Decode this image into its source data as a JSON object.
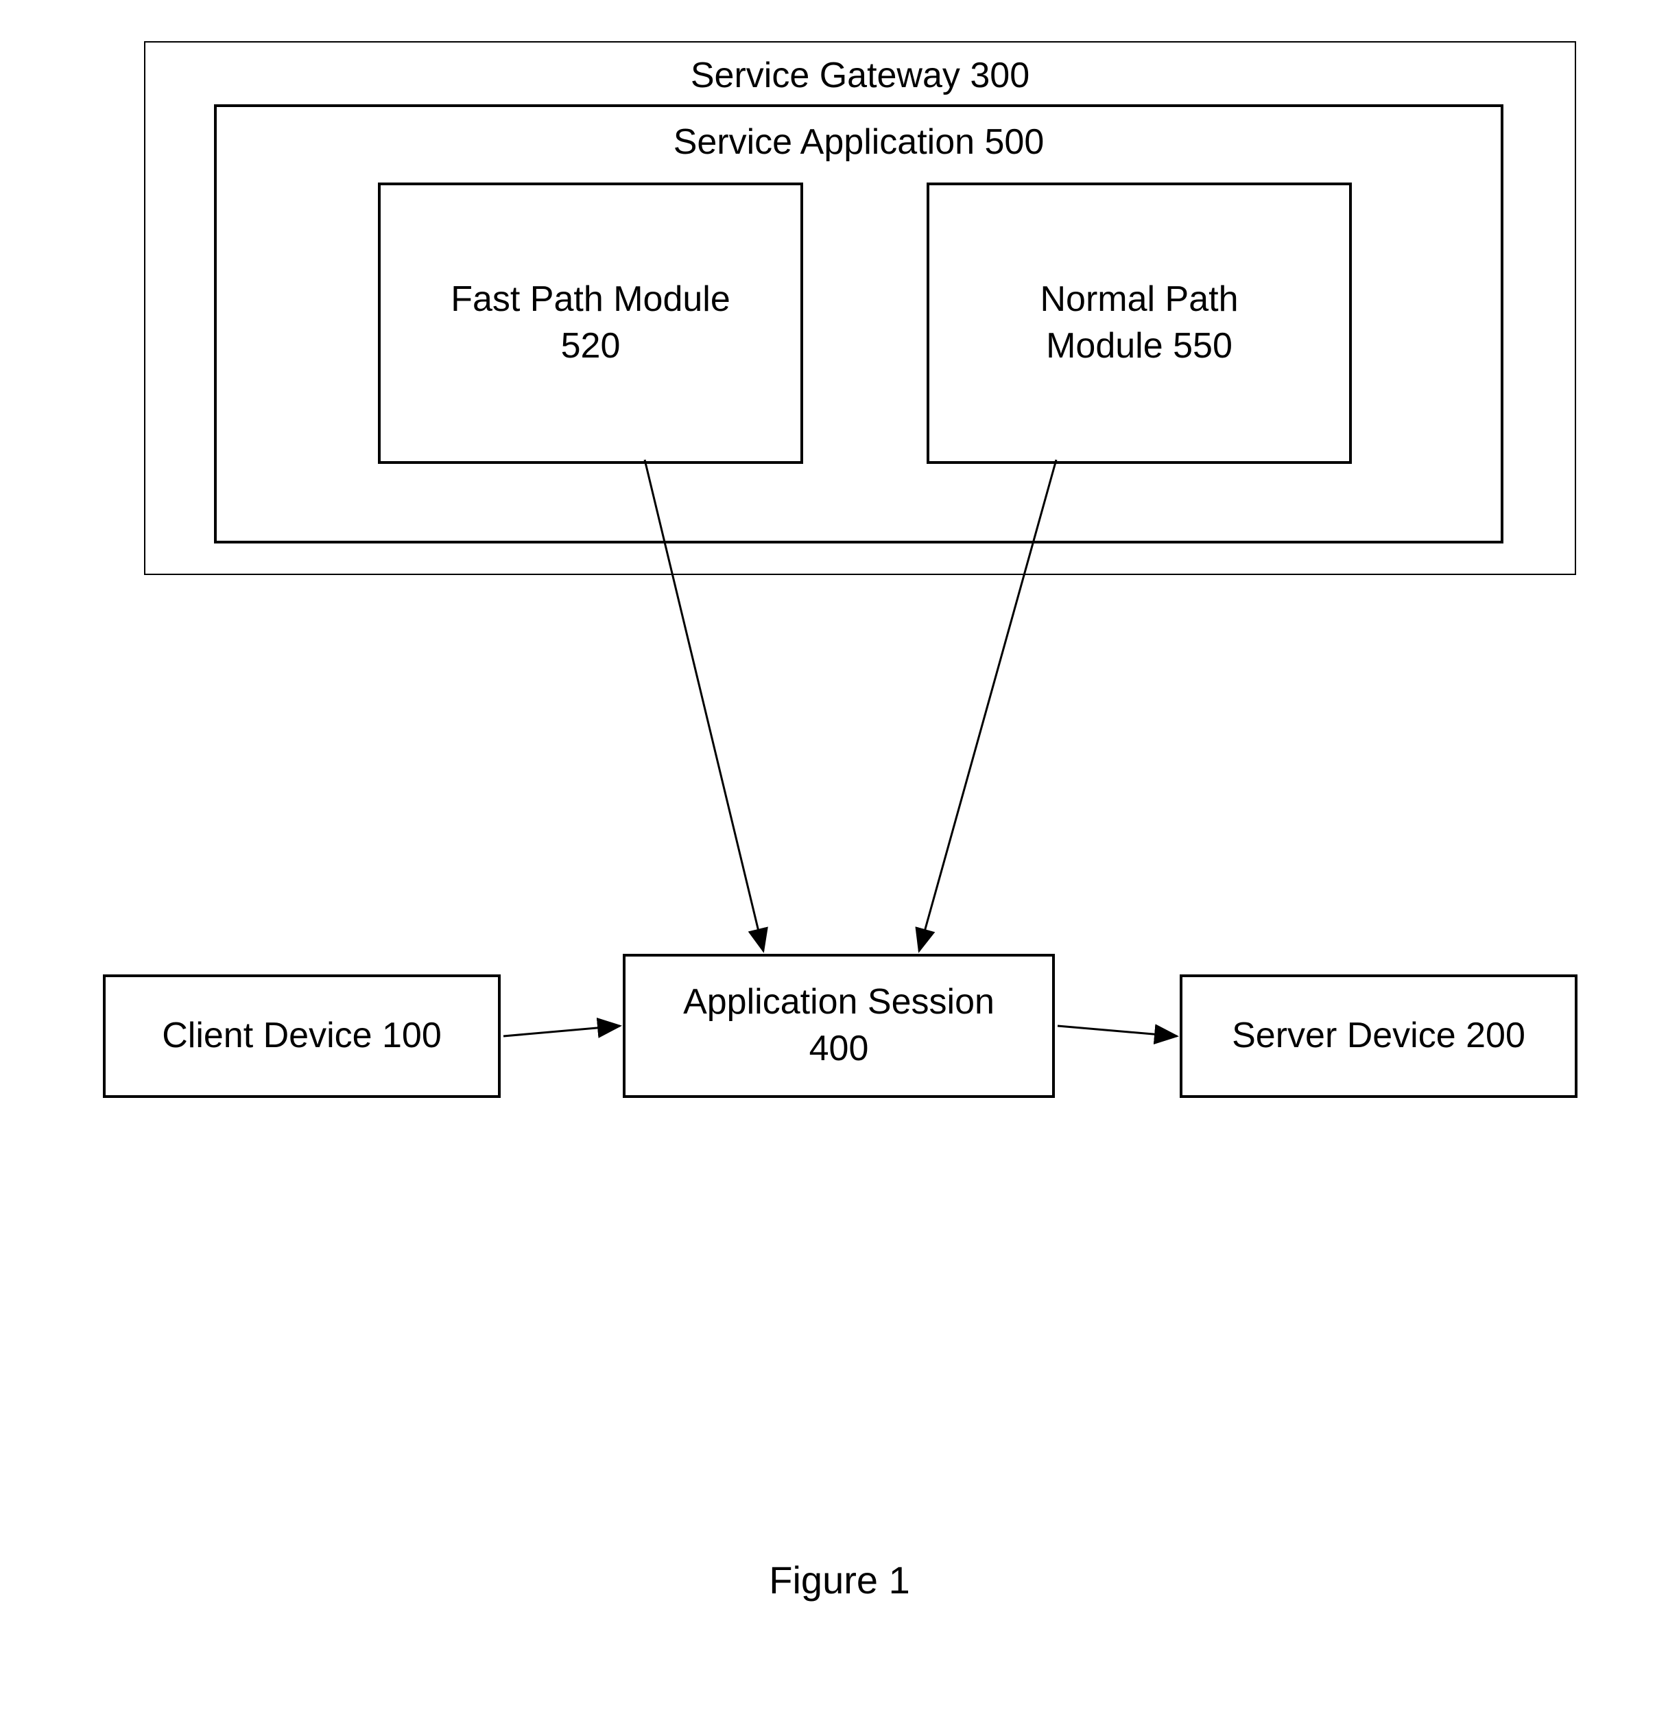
{
  "gateway": {
    "title": "Service Gateway 300"
  },
  "application": {
    "title": "Service Application 500",
    "fast_path": "Fast Path Module\n520",
    "normal_path": "Normal Path\nModule 550"
  },
  "client": {
    "label": "Client Device 100"
  },
  "session": {
    "label": "Application Session\n400"
  },
  "server": {
    "label": "Server Device 200"
  },
  "caption": "Figure 1"
}
